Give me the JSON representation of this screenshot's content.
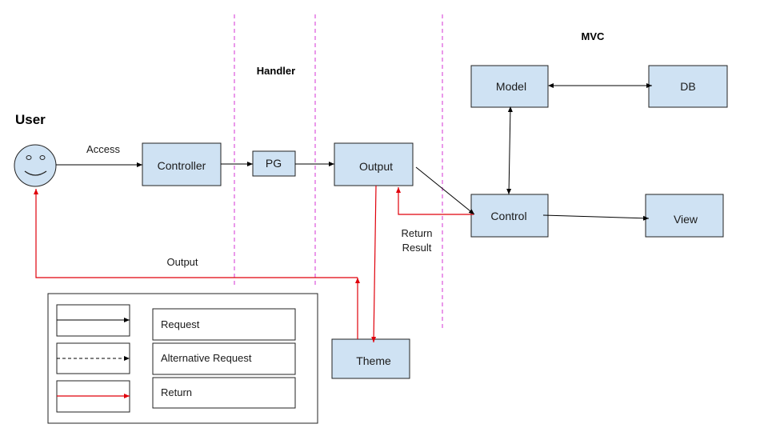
{
  "sections": {
    "user": "User",
    "handler": "Handler",
    "mvc": "MVC"
  },
  "nodes": {
    "user_face": "smiley-face",
    "controller": "Controller",
    "pg": "PG",
    "output": "Output",
    "theme": "Theme",
    "model": "Model",
    "db": "DB",
    "control": "Control",
    "view": "View"
  },
  "edge_labels": {
    "access": "Access",
    "output": "Output",
    "return_result_line1": "Return",
    "return_result_line2": "Result"
  },
  "legend": {
    "items": [
      {
        "style": "solid-black-arrow",
        "label": "Request"
      },
      {
        "style": "dashed-black-arrow",
        "label": "Alternative Request"
      },
      {
        "style": "solid-red-arrow",
        "label": "Return"
      }
    ]
  },
  "colors": {
    "node_fill": "#cfe2f3",
    "request": "#000000",
    "return": "#e0000b",
    "separator": "#d633d6"
  }
}
